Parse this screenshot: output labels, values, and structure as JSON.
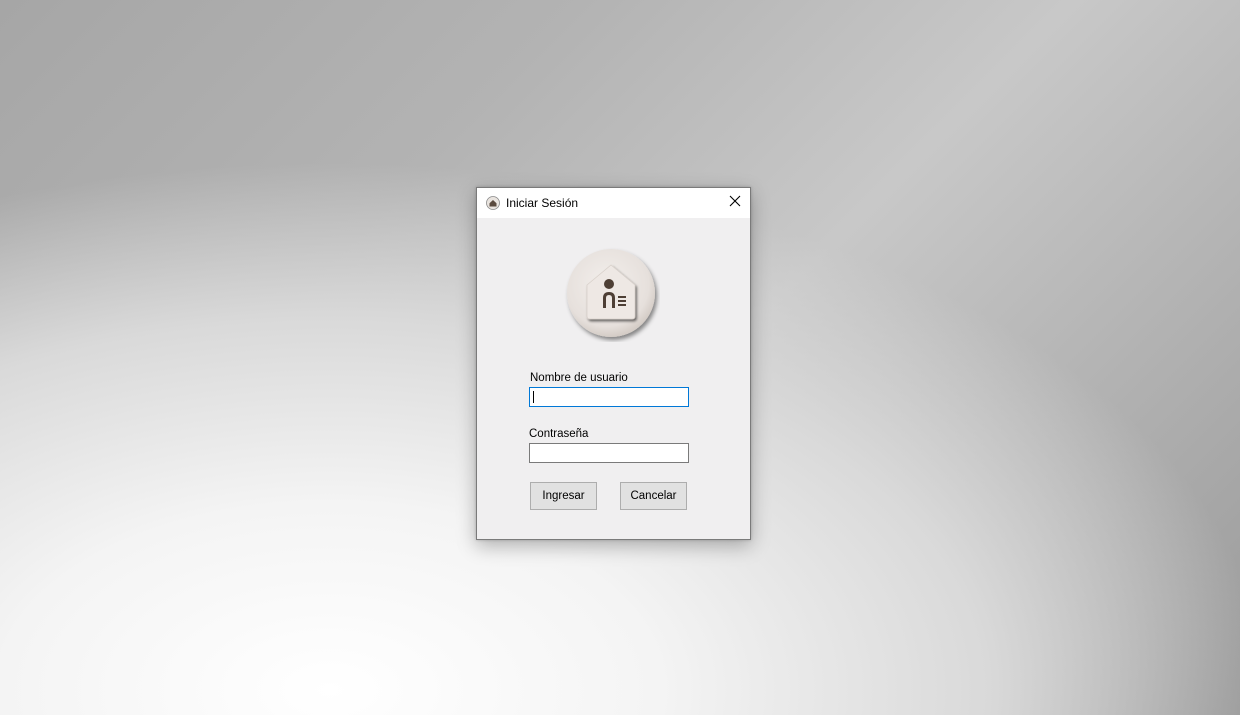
{
  "window": {
    "title": "Iniciar Sesión",
    "icon": "app-logo-icon",
    "close_icon": "close-icon"
  },
  "logo": {
    "icon": "house-user-icon"
  },
  "form": {
    "username_label": "Nombre de usuario",
    "username_value": "",
    "password_label": "Contraseña",
    "password_value": ""
  },
  "buttons": {
    "login_label": "Ingresar",
    "cancel_label": "Cancelar"
  },
  "colors": {
    "window_bg": "#f0eff0",
    "titlebar_bg": "#ffffff",
    "focus_border": "#0078d7",
    "button_bg": "#e1e1e1"
  }
}
